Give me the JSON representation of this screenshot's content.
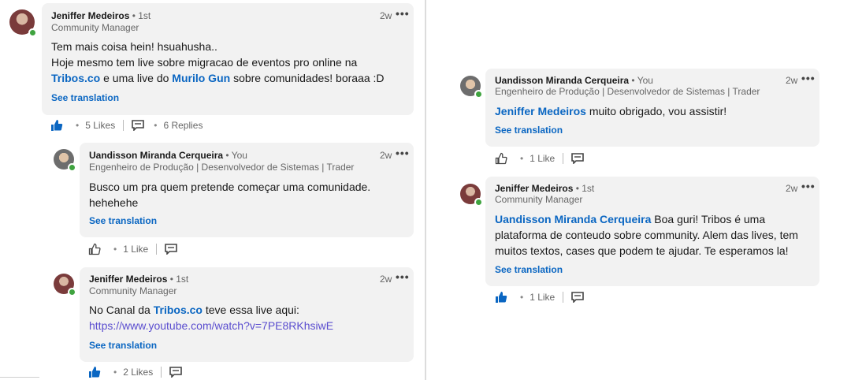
{
  "comments": [
    {
      "author": "Jeniffer Medeiros",
      "degree": "• 1st",
      "headline": "Community Manager",
      "time": "2w",
      "line1": "Tem mais coisa hein! hsuahusha..",
      "line2": "Hoje mesmo tem live sobre migracao de eventos pro online na",
      "mention1": "Tribos.co",
      "mid": " e uma live do ",
      "mention2": "Murilo Gun",
      "tail": " sobre comunidades! boraaa :D",
      "see_translation": "See translation",
      "likes": "5 Likes",
      "replies": "6 Replies"
    },
    {
      "author": "Uandisson Miranda Cerqueira",
      "degree": "• You",
      "headline": "Engenheiro de Produção | Desenvolvedor de Sistemas | Trader",
      "time": "2w",
      "line1": "Busco um pra quem pretende começar uma comunidade.",
      "line2": "hehehehe",
      "see_translation": "See translation",
      "likes": "1 Like"
    },
    {
      "author": "Jeniffer Medeiros",
      "degree": "• 1st",
      "headline": "Community Manager",
      "time": "2w",
      "prefix": "No Canal da ",
      "mention": "Tribos.co",
      "suffix": " teve essa live aqui:",
      "link": "https://www.youtube.com/watch?v=7PE8RKhsiwE",
      "see_translation": "See translation",
      "likes": "2 Likes"
    },
    {
      "author": "Uandisson Miranda Cerqueira",
      "degree": "• You",
      "headline": "Engenheiro de Produção | Desenvolvedor de Sistemas | Trader",
      "time": "2w",
      "mention": "Jeniffer Medeiros",
      "rest": " muito obrigado, vou assistir!",
      "see_translation": "See translation",
      "likes": "1 Like"
    },
    {
      "author": "Jeniffer Medeiros",
      "degree": "• 1st",
      "headline": "Community Manager",
      "time": "2w",
      "mention": "Uandisson Miranda Cerqueira",
      "rest1": " Boa guri! Tribos é uma",
      "line2": "plataforma de conteudo sobre community. Alem das lives, tem",
      "line3": "muitos textos, cases que podem te ajudar. Te esperamos la!",
      "see_translation": "See translation",
      "likes": "1 Like"
    }
  ],
  "icons": {
    "like": "thumbs-up-icon",
    "reply": "comment-icon",
    "more": "more-options-icon",
    "online": "online-status-icon"
  },
  "colors": {
    "link": "#0a66c2",
    "url": "#5a4dcf",
    "liked": "#0a66c2",
    "online": "#3fa33f",
    "bubble": "#f2f2f2"
  }
}
